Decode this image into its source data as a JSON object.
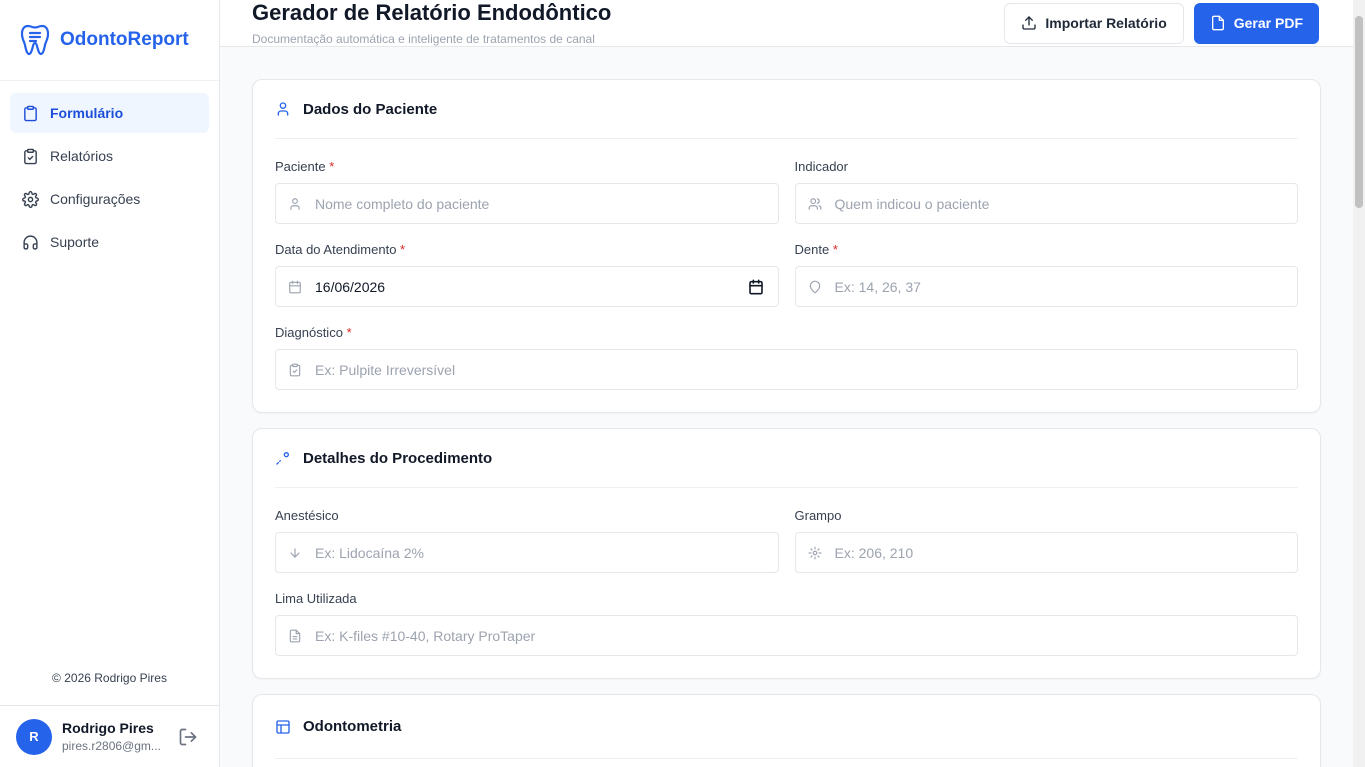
{
  "brand": {
    "name": "OdontoReport",
    "accent": "#2563eb"
  },
  "sidebar": {
    "items": [
      {
        "label": "Formulário",
        "icon": "clipboard-icon",
        "active": true
      },
      {
        "label": "Relatórios",
        "icon": "clipboard-check-icon"
      },
      {
        "label": "Configurações",
        "icon": "gear-icon"
      },
      {
        "label": "Suporte",
        "icon": "headset-icon"
      }
    ],
    "copyright": "© 2026 Rodrigo Pires"
  },
  "user": {
    "initial": "R",
    "name": "Rodrigo Pires",
    "email": "pires.r2806@gm..."
  },
  "header": {
    "title": "Gerador de Relatório Endodôntico",
    "subtitle": "Documentação automática e inteligente de tratamentos de canal",
    "import_label": "Importar Relatório",
    "pdf_label": "Gerar PDF"
  },
  "patient": {
    "title": "Dados do Paciente",
    "paciente_label": "Paciente",
    "paciente_placeholder": "Nome completo do paciente",
    "indicador_label": "Indicador",
    "indicador_placeholder": "Quem indicou o paciente",
    "data_label": "Data do Atendimento",
    "data_value": "16/06/2026",
    "dente_label": "Dente",
    "dente_placeholder": "Ex: 14, 26, 37",
    "diagnostico_label": "Diagnóstico",
    "diagnostico_placeholder": "Ex: Pulpite Irreversível",
    "required_mark": "*"
  },
  "procedure": {
    "title": "Detalhes do Procedimento",
    "anestesico_label": "Anestésico",
    "anestesico_placeholder": "Ex: Lidocaína 2%",
    "grampo_label": "Grampo",
    "grampo_placeholder": "Ex: 206, 210",
    "lima_label": "Lima Utilizada",
    "lima_placeholder": "Ex: K-files #10-40, Rotary ProTaper"
  },
  "odontometria": {
    "title": "Odontometria"
  }
}
